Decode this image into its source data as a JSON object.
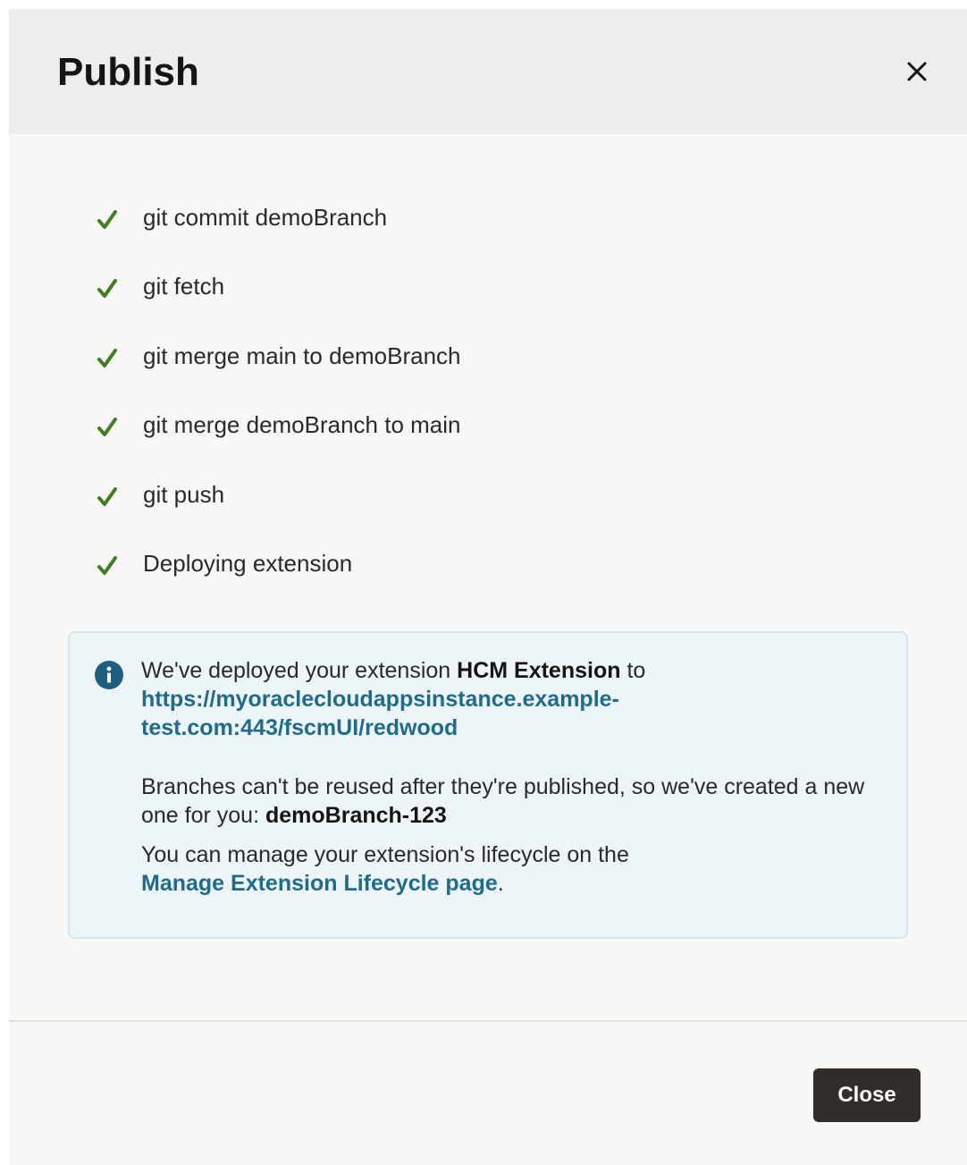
{
  "dialog": {
    "title": "Publish",
    "close_icon": "close-icon"
  },
  "steps": [
    {
      "label": "git commit demoBranch",
      "status": "done",
      "icon": "checkmark-icon"
    },
    {
      "label": "git fetch",
      "status": "done",
      "icon": "checkmark-icon"
    },
    {
      "label": "git merge main to demoBranch",
      "status": "done",
      "icon": "checkmark-icon"
    },
    {
      "label": "git merge demoBranch to main",
      "status": "done",
      "icon": "checkmark-icon"
    },
    {
      "label": "git push",
      "status": "done",
      "icon": "checkmark-icon"
    },
    {
      "label": "Deploying extension",
      "status": "done",
      "icon": "checkmark-icon"
    }
  ],
  "info": {
    "icon": "info-icon",
    "deployed_prefix": "We've deployed your extension ",
    "extension_name": "HCM Extension",
    "deployed_suffix": " to",
    "url_line1": "https://myoraclecloudappsinstance.example-",
    "url_line2": "test.com:443/fscmUI/redwood",
    "branch_prefix": "Branches can't be reused after they're published, so we've created a new one for you: ",
    "branch_name": "demoBranch-123",
    "manage_prefix": "You can manage your extension's lifecycle on the",
    "manage_link": "Manage Extension Lifecycle page",
    "manage_suffix": "."
  },
  "footer": {
    "close_label": "Close"
  },
  "colors": {
    "check": "#3f7d20",
    "info_icon": "#1e5f80",
    "link": "#1e6b8c",
    "button_bg": "#312d2a"
  }
}
